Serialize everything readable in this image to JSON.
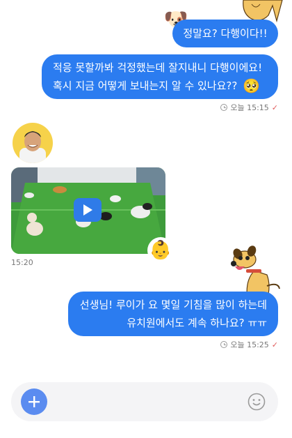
{
  "messages": [
    {
      "text": "정말요? 다행이다!!"
    },
    {
      "line1": "적응 못할까봐 걱정했는데 잘지내니 다행이에요!",
      "line2": "혹시 지금 어떻게 보내는지 알 수 있나요??",
      "emoji": "🥺",
      "time": "오늘 15:15"
    },
    {
      "time": "15:20"
    },
    {
      "line1": "선생님! 루이가 요 몇일 기침을 많이 하는데",
      "line2": "유치원에서도 계속 하나요? ㅠㅠ",
      "time": "오늘 15:25"
    }
  ],
  "avatars": {
    "dog": "🐶",
    "baby": "👶"
  },
  "colors": {
    "bubble": "#2b7cf0",
    "accent_red": "#e05a5a",
    "input_bg": "#f4f4f6",
    "plus_button": "#5b8cf0"
  },
  "icons": [
    "clock-icon",
    "check-icon",
    "play-icon",
    "plus-icon",
    "emoji-icon"
  ]
}
